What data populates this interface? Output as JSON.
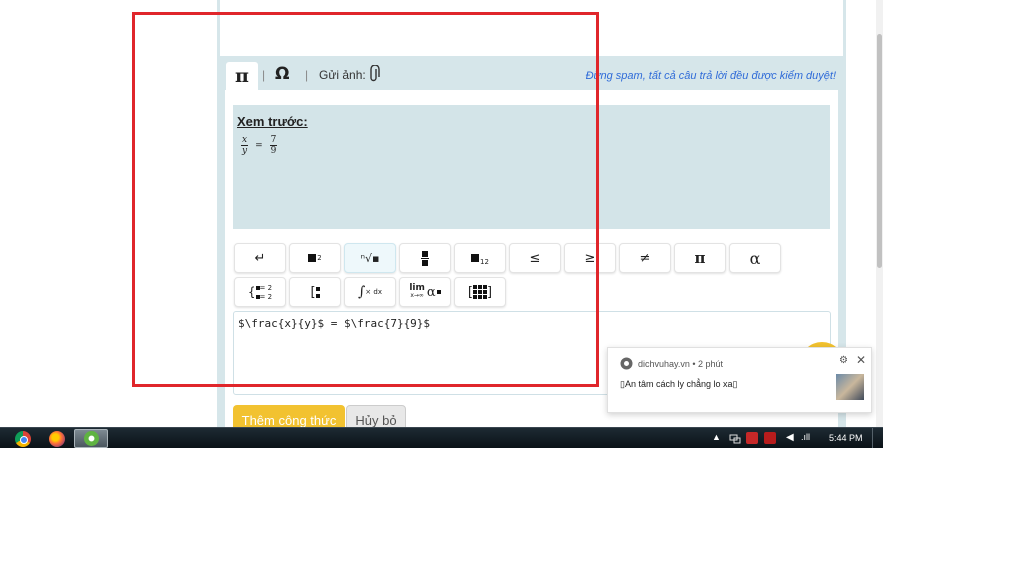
{
  "toolbar": {
    "tab_pi": "π",
    "tab_omega": "Ω",
    "sep": "|",
    "upload_label": "Gửi ảnh:",
    "notice": "Đừng spam, tất cả câu trả lời đều được kiểm duyệt!"
  },
  "preview": {
    "label": "Xem trước:",
    "num1": "x",
    "den1": "y",
    "equals": "=",
    "num2": "7",
    "den2": "9"
  },
  "buttons": {
    "enter": "↵",
    "power_sup": "2",
    "sqrt": "ⁿ√▪",
    "sub": "12",
    "le": "≤",
    "ge": "≥",
    "ne": "≠",
    "pi": "π",
    "alpha": "α",
    "system_text": "= 2",
    "integral_text": "× dx",
    "lim": "lim",
    "lim_sub": "x→∞",
    "lim_alpha": "α"
  },
  "input": {
    "value": "$\\frac{x}{y}$ = $\\frac{7}{9}$"
  },
  "actions": {
    "add_formula": "Thêm công thức",
    "cancel": "Hủy bỏ"
  },
  "notification": {
    "source": "dichvuhay.vn  •  2 phút",
    "body": "▯An tâm cách ly chẳng lo xa▯",
    "gear": "⚙",
    "close": "✕"
  },
  "taskbar": {
    "tray_arrow": "▲",
    "volume": "◀",
    "signal": ".ıll",
    "clock": "5:44 PM"
  },
  "colors": {
    "accent_yellow": "#f2c230",
    "panel": "#d6e6ea",
    "notice_blue": "#2f6bd8",
    "frame_red": "#e0262b"
  }
}
